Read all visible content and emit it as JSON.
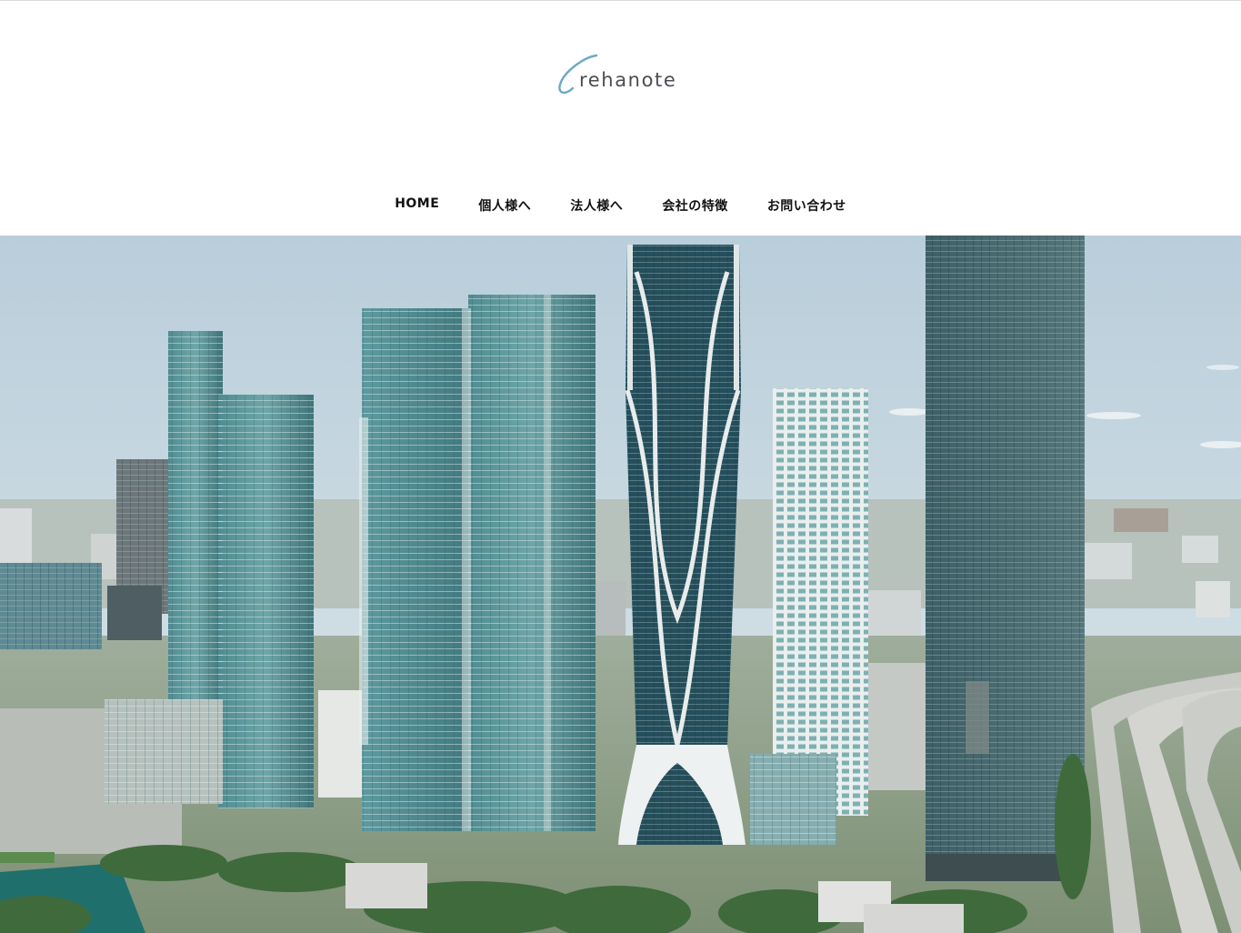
{
  "brand": {
    "logo_text": "rehanote",
    "accent_color": "#6aa9c4"
  },
  "nav": {
    "items": [
      {
        "label": "HOME"
      },
      {
        "label": "個人様へ"
      },
      {
        "label": "法人様へ"
      },
      {
        "label": "会社の特徴"
      },
      {
        "label": "お問い合わせ"
      }
    ]
  },
  "hero": {
    "description_icon": "city-skyline-photo"
  }
}
